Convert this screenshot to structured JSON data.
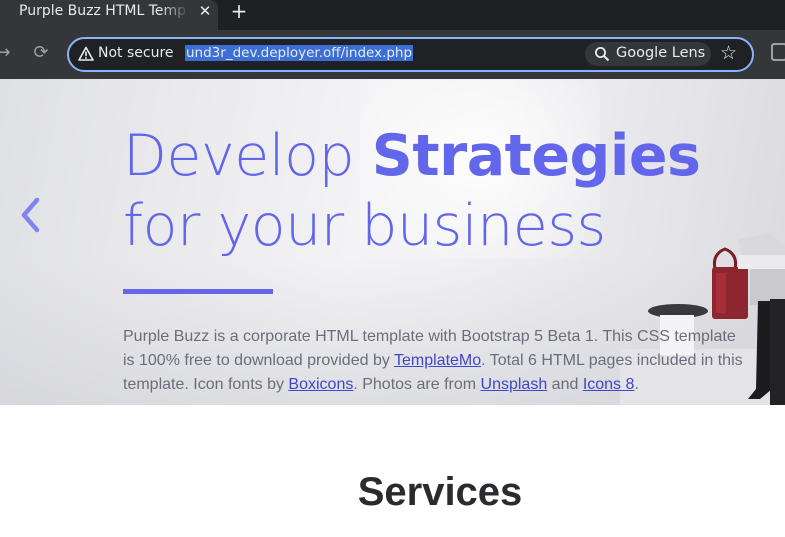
{
  "browser": {
    "tab": {
      "title": "Purple Buzz HTML Templ",
      "close_glyph": "✕"
    },
    "new_tab_glyph": "+",
    "nav": {
      "back_glyph": "→",
      "reload_glyph": "⟳"
    },
    "omnibox": {
      "security_label": "Not secure",
      "url": "und3r_dev.deployer.off/index.php",
      "lens_label": "Google Lens",
      "bookmark_glyph": "☆"
    }
  },
  "hero": {
    "title_part1": "Develop ",
    "title_bold": "Strategies",
    "title_part2": " for your business",
    "description": {
      "t1": "Purple Buzz is a corporate HTML template with Bootstrap 5 Beta 1. This CSS template is 100% free to download provided by ",
      "link_templatemo": "TemplateMo",
      "t2": ". Total 6 HTML pages included in this template. Icon fonts by ",
      "link_boxicons": "Boxicons",
      "t3": ". Photos are from ",
      "link_unsplash": "Unsplash",
      "t4": " and ",
      "link_icons8": "Icons 8",
      "t5": "."
    },
    "colors": {
      "accent": "#6266ea",
      "text": "#6b6d7a"
    }
  },
  "services": {
    "heading": "Services"
  }
}
